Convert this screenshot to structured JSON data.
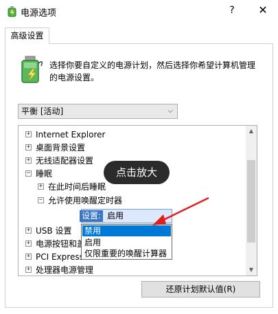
{
  "window": {
    "title": "电源选项",
    "help": "?",
    "close": "✕"
  },
  "tabs": [
    {
      "label": "高级设置",
      "active": true
    }
  ],
  "description": "选择你要自定义的电源计划，然后选择你希望计算机管理的电源设置。",
  "plan_select": {
    "value": "平衡 [活动]"
  },
  "tree": {
    "items": [
      {
        "label": "Internet Explorer",
        "toggle": "+"
      },
      {
        "label": "桌面背景设置",
        "toggle": "+"
      },
      {
        "label": "无线适配器设置",
        "toggle": "+"
      },
      {
        "label": "睡眠",
        "toggle": "−"
      },
      {
        "label": "在此时间后睡眠",
        "toggle": "+"
      },
      {
        "label": "允许使用唤醒定时器",
        "toggle": "−"
      },
      {
        "label": "USB 设置",
        "toggle": "+"
      },
      {
        "label": "电源按钮和盖",
        "toggle": "+"
      },
      {
        "label": "PCI Express",
        "toggle": "+"
      },
      {
        "label": "处理器电源管理",
        "toggle": "+"
      }
    ],
    "setting_label": "设置:",
    "setting_value": "启用"
  },
  "dropdown": {
    "options": [
      "禁用",
      "启用",
      "仅限重要的唤醒计算器"
    ],
    "selected_index": 0
  },
  "callout": {
    "text": "点击放大"
  },
  "buttons": {
    "restore": "还原计划默认值(R)"
  },
  "colors": {
    "selection": "#0078d7",
    "callout": "#2b2b2b",
    "arrow": "#e02020"
  }
}
